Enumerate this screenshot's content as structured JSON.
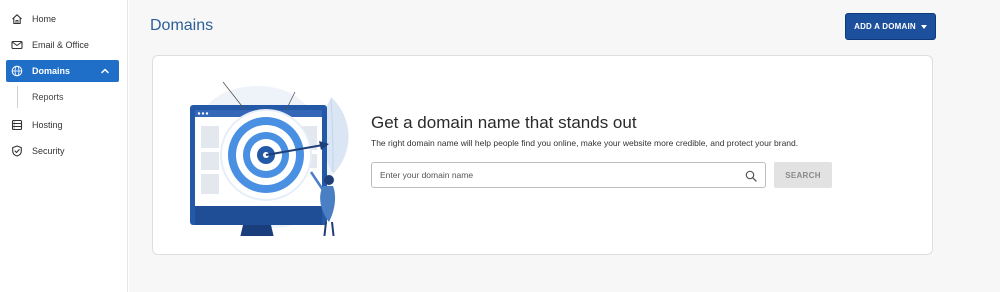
{
  "sidebar": {
    "items": [
      {
        "label": "Home",
        "icon": "home-icon"
      },
      {
        "label": "Email & Office",
        "icon": "mail-icon"
      },
      {
        "label": "Domains",
        "icon": "globe-icon",
        "active": true
      },
      {
        "label": "Hosting",
        "icon": "server-icon"
      },
      {
        "label": "Security",
        "icon": "shield-icon"
      }
    ],
    "subitems": [
      {
        "label": "Reports"
      }
    ]
  },
  "header": {
    "title": "Domains",
    "add_button_label": "ADD A DOMAIN"
  },
  "card": {
    "headline": "Get a domain name that stands out",
    "subtext": "The right domain name will help people find you online, make your website more credible, and protect your brand.",
    "search_placeholder": "Enter your domain name",
    "search_value": "",
    "search_button_label": "SEARCH"
  },
  "colors": {
    "accent": "#1f6fc9",
    "button_primary": "#1c4f9c",
    "title": "#2c5f98"
  }
}
